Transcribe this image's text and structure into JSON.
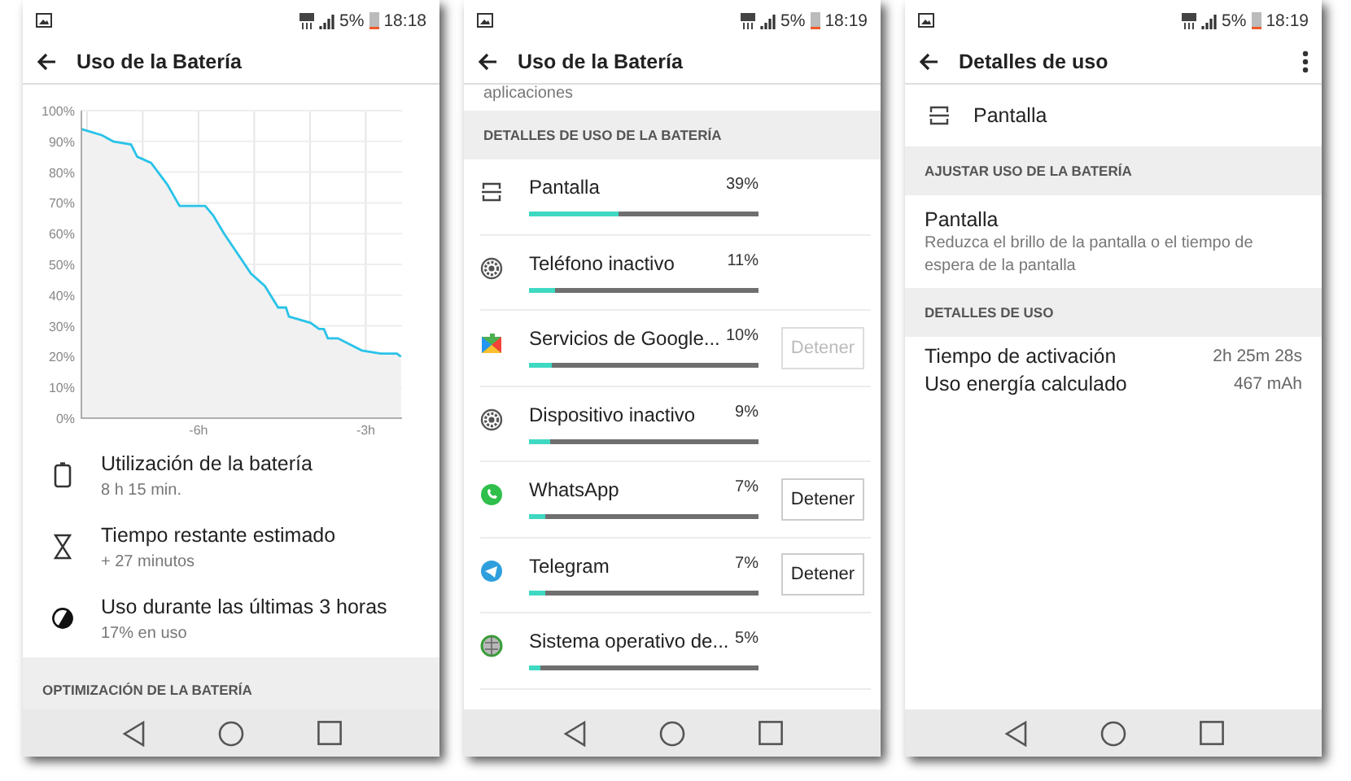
{
  "screens": [
    {
      "kind": "summary",
      "status_bar": {
        "battery": "5%",
        "time": "18:18"
      },
      "app_bar": {
        "title": "Uso de la Batería",
        "overflow_menu": false
      },
      "chart_data": {
        "type": "area",
        "x": [
          -8.1,
          -7.73,
          -7.53,
          -7.21,
          -7.1,
          -6.85,
          -6.56,
          -6.34,
          -5.88,
          -5.74,
          -5.54,
          -5.06,
          -4.81,
          -4.57,
          -4.43,
          -4.38,
          -3.99,
          -3.84,
          -3.75,
          -3.68,
          -3.5,
          -3.07,
          -2.73,
          -2.44,
          -2.37
        ],
        "series": [
          {
            "color": "#29c3e8",
            "values": [
              94,
              92,
              90,
              89,
              85,
              83,
              76,
              69,
              69,
              66,
              60,
              47,
              43,
              36,
              36,
              33,
              31,
              29,
              29,
              26,
              26,
              22,
              21,
              21,
              20
            ]
          }
        ],
        "grid": true,
        "xlim": [
          -8.1,
          -2.35
        ],
        "ylim": [
          0,
          100
        ],
        "xticks": [
          {
            "value": -6,
            "label": "-6h"
          },
          {
            "value": -3,
            "label": "-3h"
          }
        ],
        "yticks": [
          {
            "value": 0,
            "label": "0%"
          },
          {
            "value": 10,
            "label": "10%"
          },
          {
            "value": 20,
            "label": "20%"
          },
          {
            "value": 30,
            "label": "30%"
          },
          {
            "value": 40,
            "label": "40%"
          },
          {
            "value": 50,
            "label": "50%"
          },
          {
            "value": 60,
            "label": "60%"
          },
          {
            "value": 70,
            "label": "70%"
          },
          {
            "value": 80,
            "label": "80%"
          },
          {
            "value": 90,
            "label": "90%"
          },
          {
            "value": 100,
            "label": "100%"
          }
        ]
      },
      "items": [
        {
          "title": "Utilización de la batería",
          "subtitle": "8 h 15 min."
        },
        {
          "title": "Tiempo restante estimado",
          "subtitle": "+ 27 minutos"
        },
        {
          "title": "Uso durante las últimas 3 horas",
          "subtitle": "17% en uso"
        }
      ],
      "section": "OPTIMIZACIÓN DE LA BATERÍA"
    },
    {
      "kind": "usage_list",
      "status_bar": {
        "battery": "5%",
        "time": "18:19"
      },
      "app_bar": {
        "title": "Uso de la Batería",
        "overflow_menu": false
      },
      "cut_text": "aplicaciones",
      "section": "DETALLES DE USO DE LA BATERÍA",
      "items": [
        {
          "name": "Pantalla",
          "percent": "39%",
          "level": 0.39
        },
        {
          "name": "Teléfono inactivo",
          "percent": "11%",
          "level": 0.11
        },
        {
          "name": "Servicios de Google...",
          "percent": "10%",
          "level": 0.1,
          "button": {
            "label": "Detener",
            "disabled": true
          }
        },
        {
          "name": "Dispositivo inactivo",
          "percent": "9%",
          "level": 0.09
        },
        {
          "name": "WhatsApp",
          "percent": "7%",
          "level": 0.07,
          "button": {
            "label": "Detener",
            "disabled": false
          }
        },
        {
          "name": "Telegram",
          "percent": "7%",
          "level": 0.07,
          "button": {
            "label": "Detener",
            "disabled": false
          }
        },
        {
          "name": "Sistema operativo de...",
          "percent": "5%",
          "level": 0.05
        }
      ]
    },
    {
      "kind": "details",
      "status_bar": {
        "battery": "5%",
        "time": "18:19"
      },
      "app_bar": {
        "title": "Detalles de uso",
        "overflow_menu": true
      },
      "header": "Pantalla",
      "adjust_section": "AJUSTAR USO DE LA BATERÍA",
      "adjust_item": {
        "title": "Pantalla",
        "description": "Reduzca el brillo de la pantalla o el tiempo de espera de la pantalla"
      },
      "details_section": "DETALLES DE USO",
      "details": [
        {
          "label": "Tiempo de activación",
          "value": "2h 25m 28s"
        },
        {
          "label": "Uso energía calculado",
          "value": "467 mAh"
        }
      ]
    }
  ]
}
